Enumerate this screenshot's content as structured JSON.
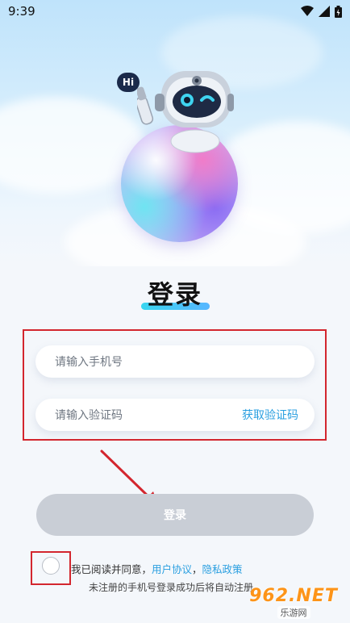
{
  "status_bar": {
    "time": "9:39"
  },
  "hero": {
    "bubble_text": "Hi"
  },
  "page": {
    "title": "登录"
  },
  "form": {
    "phone": {
      "placeholder": "请输入手机号"
    },
    "code": {
      "placeholder": "请输入验证码",
      "get_code_label": "获取验证码"
    }
  },
  "login_button": {
    "label": "登录"
  },
  "agreement": {
    "prefix": "我已阅读并同意，",
    "user_agreement": "用户协议",
    "separator": "，",
    "privacy_policy": "隐私政策",
    "note": "未注册的手机号登录成功后将自动注册"
  },
  "watermark": {
    "main": "962.NET",
    "sub": "乐游网"
  },
  "colors": {
    "accent": "#2a9fe0",
    "highlight_box": "#d3262e",
    "disabled_button": "#c9ced6",
    "title_underline": "#39d6f0"
  }
}
